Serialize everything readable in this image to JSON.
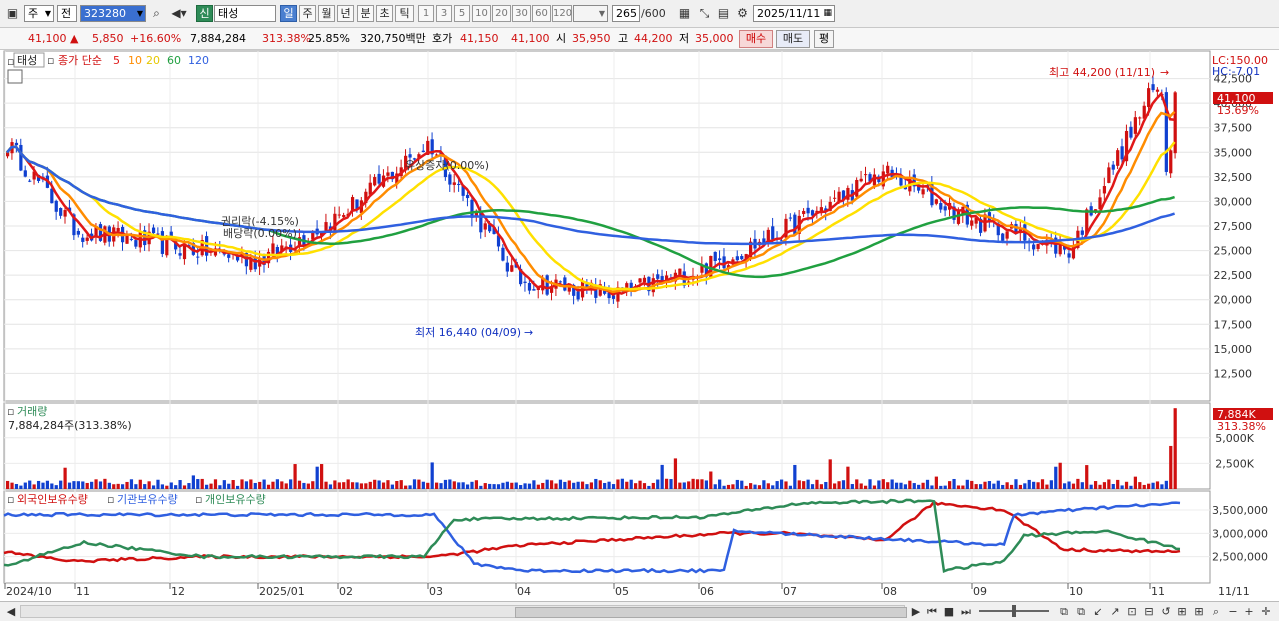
{
  "toolbar": {
    "market_type": "주",
    "mode": "전",
    "code": "323280",
    "badge": "신",
    "name": "태성",
    "periods": [
      "일",
      "주",
      "월",
      "년",
      "분",
      "초",
      "틱"
    ],
    "minutes": [
      "1",
      "3",
      "5",
      "10",
      "20",
      "30",
      "60",
      "120"
    ],
    "count": "265",
    "count_total": "/600",
    "date": "2025/11/11"
  },
  "infobar": {
    "price": "41,100",
    "change": "5,850",
    "change_pct": "+16.60%",
    "volume": "7,884,284",
    "volume_pct": "313.38%",
    "turnover": "25.85%",
    "amount": "320,750백만",
    "quote_label": "호가",
    "ask": "41,150",
    "bid": "41,100",
    "open_label": "시",
    "open": "35,950",
    "high_label": "고",
    "high": "44,200",
    "low_label": "저",
    "low": "35,000",
    "buy": "매수",
    "sell": "매도",
    "eval": "평"
  },
  "price_legend": {
    "stock": "태성",
    "ma_label": "종가 단순",
    "ma_periods": [
      "5",
      "10",
      "20",
      "60",
      "120"
    ]
  },
  "price_axis": {
    "lc": "LC:150.00",
    "hc": "HC:-7.01",
    "ticks": [
      "42,500",
      "40,000",
      "37,500",
      "35,000",
      "32,500",
      "30,000",
      "27,500",
      "25,000",
      "22,500",
      "20,000",
      "17,500",
      "15,000",
      "12,500"
    ],
    "current": "41,100",
    "current_pct": "13.69%"
  },
  "annotations": {
    "high": "최고 44,200 (11/11)",
    "low": "최저 16,440 (04/09)",
    "capital_increase": "유상증자(0.00%)",
    "ex_rights": "권리락(-4.15%)",
    "ex_dividend": "배당락(0.00%)"
  },
  "volume_panel": {
    "title": "거래량",
    "value": "7,884,284주(313.38%)",
    "current": "7,884K",
    "current_pct": "313.38%",
    "ticks": [
      "5,000K",
      "2,500K"
    ]
  },
  "holdings_panel": {
    "legend": [
      "외국인보유수량",
      "기관보유수량",
      "개인보유수량"
    ],
    "ticks": [
      "3,500,000",
      "3,000,000",
      "2,500,000"
    ]
  },
  "x_axis": {
    "labels": [
      "2024/10",
      "11",
      "12",
      "2025/01",
      "02",
      "03",
      "04",
      "05",
      "06",
      "07",
      "08",
      "09",
      "10",
      "11"
    ],
    "right_label": "11/11"
  },
  "colors": {
    "up": "#d01010",
    "down": "#1040d0",
    "ma5": "#e01818",
    "ma10": "#ff8c00",
    "ma20": "#ffe000",
    "ma60": "#20a040",
    "ma120": "#3060e0",
    "foreign": "#d01010",
    "institution": "#2f5fe0",
    "individual": "#2e8b57"
  },
  "chart_data": {
    "type": "line",
    "title": "",
    "xlabel": "",
    "ylabel": "",
    "x": [
      "2024/10",
      "11",
      "12",
      "2025/01",
      "02",
      "03",
      "04",
      "05",
      "06",
      "07",
      "08",
      "09",
      "10",
      "11"
    ],
    "ylim": [
      10000,
      45000
    ],
    "series": [
      {
        "name": "태성",
        "values": [
          36000,
          27000,
          25500,
          24000,
          28500,
          36000,
          22000,
          20500,
          23000,
          27000,
          33000,
          28000,
          25000,
          41100
        ]
      }
    ]
  }
}
